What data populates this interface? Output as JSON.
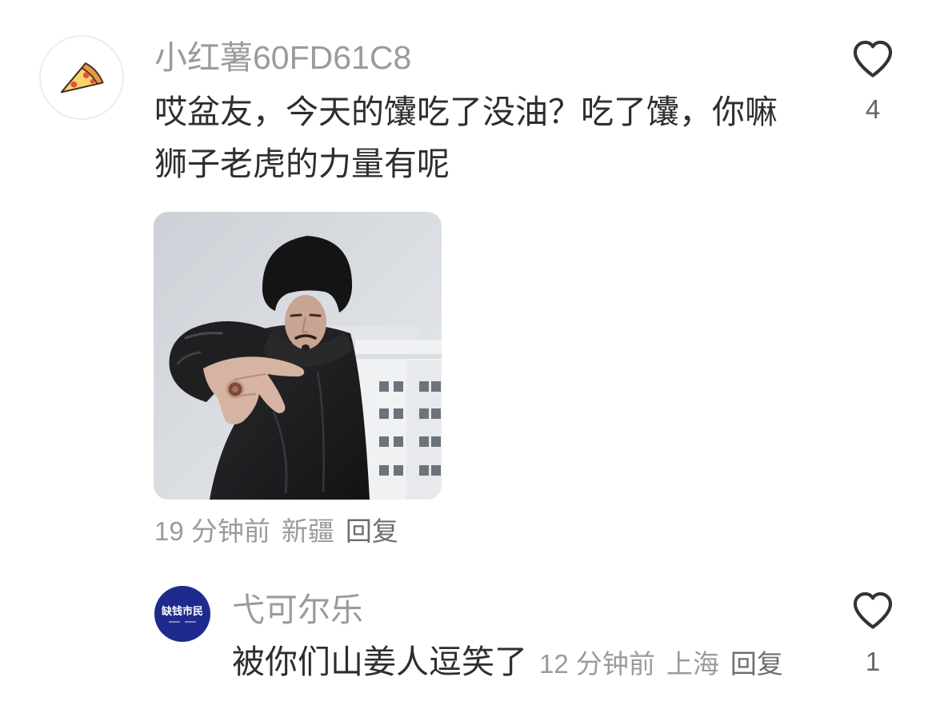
{
  "colors": {
    "background": "#ffffff",
    "text_primary": "#2e2e2e",
    "text_secondary": "#9b9b9b",
    "reply_label": "#6e6e6e",
    "like_count": "#666666",
    "heart_stroke": "#333333",
    "avatar_border": "#ededed",
    "reply_avatar_bg": "#1e2b8c"
  },
  "icons": {
    "commenter_avatar": "pizza-slice-icon",
    "like": "heart-outline-icon"
  },
  "comment": {
    "username": "小红薯60FD61C8",
    "text_lines": [
      "哎盆友，今天的馕吃了没油？吃了馕，你嘛",
      "狮子老虎的力量有呢"
    ],
    "time": "19 分钟前",
    "location": "新疆",
    "reply_label": "回复",
    "like_count": "4",
    "reply": {
      "avatar_text": "缺钱市民",
      "username": "弋可尔乐",
      "text": "被你们山姜人逗笑了",
      "time": "12 分钟前",
      "location": "上海",
      "reply_label": "回复",
      "like_count": "1"
    }
  }
}
